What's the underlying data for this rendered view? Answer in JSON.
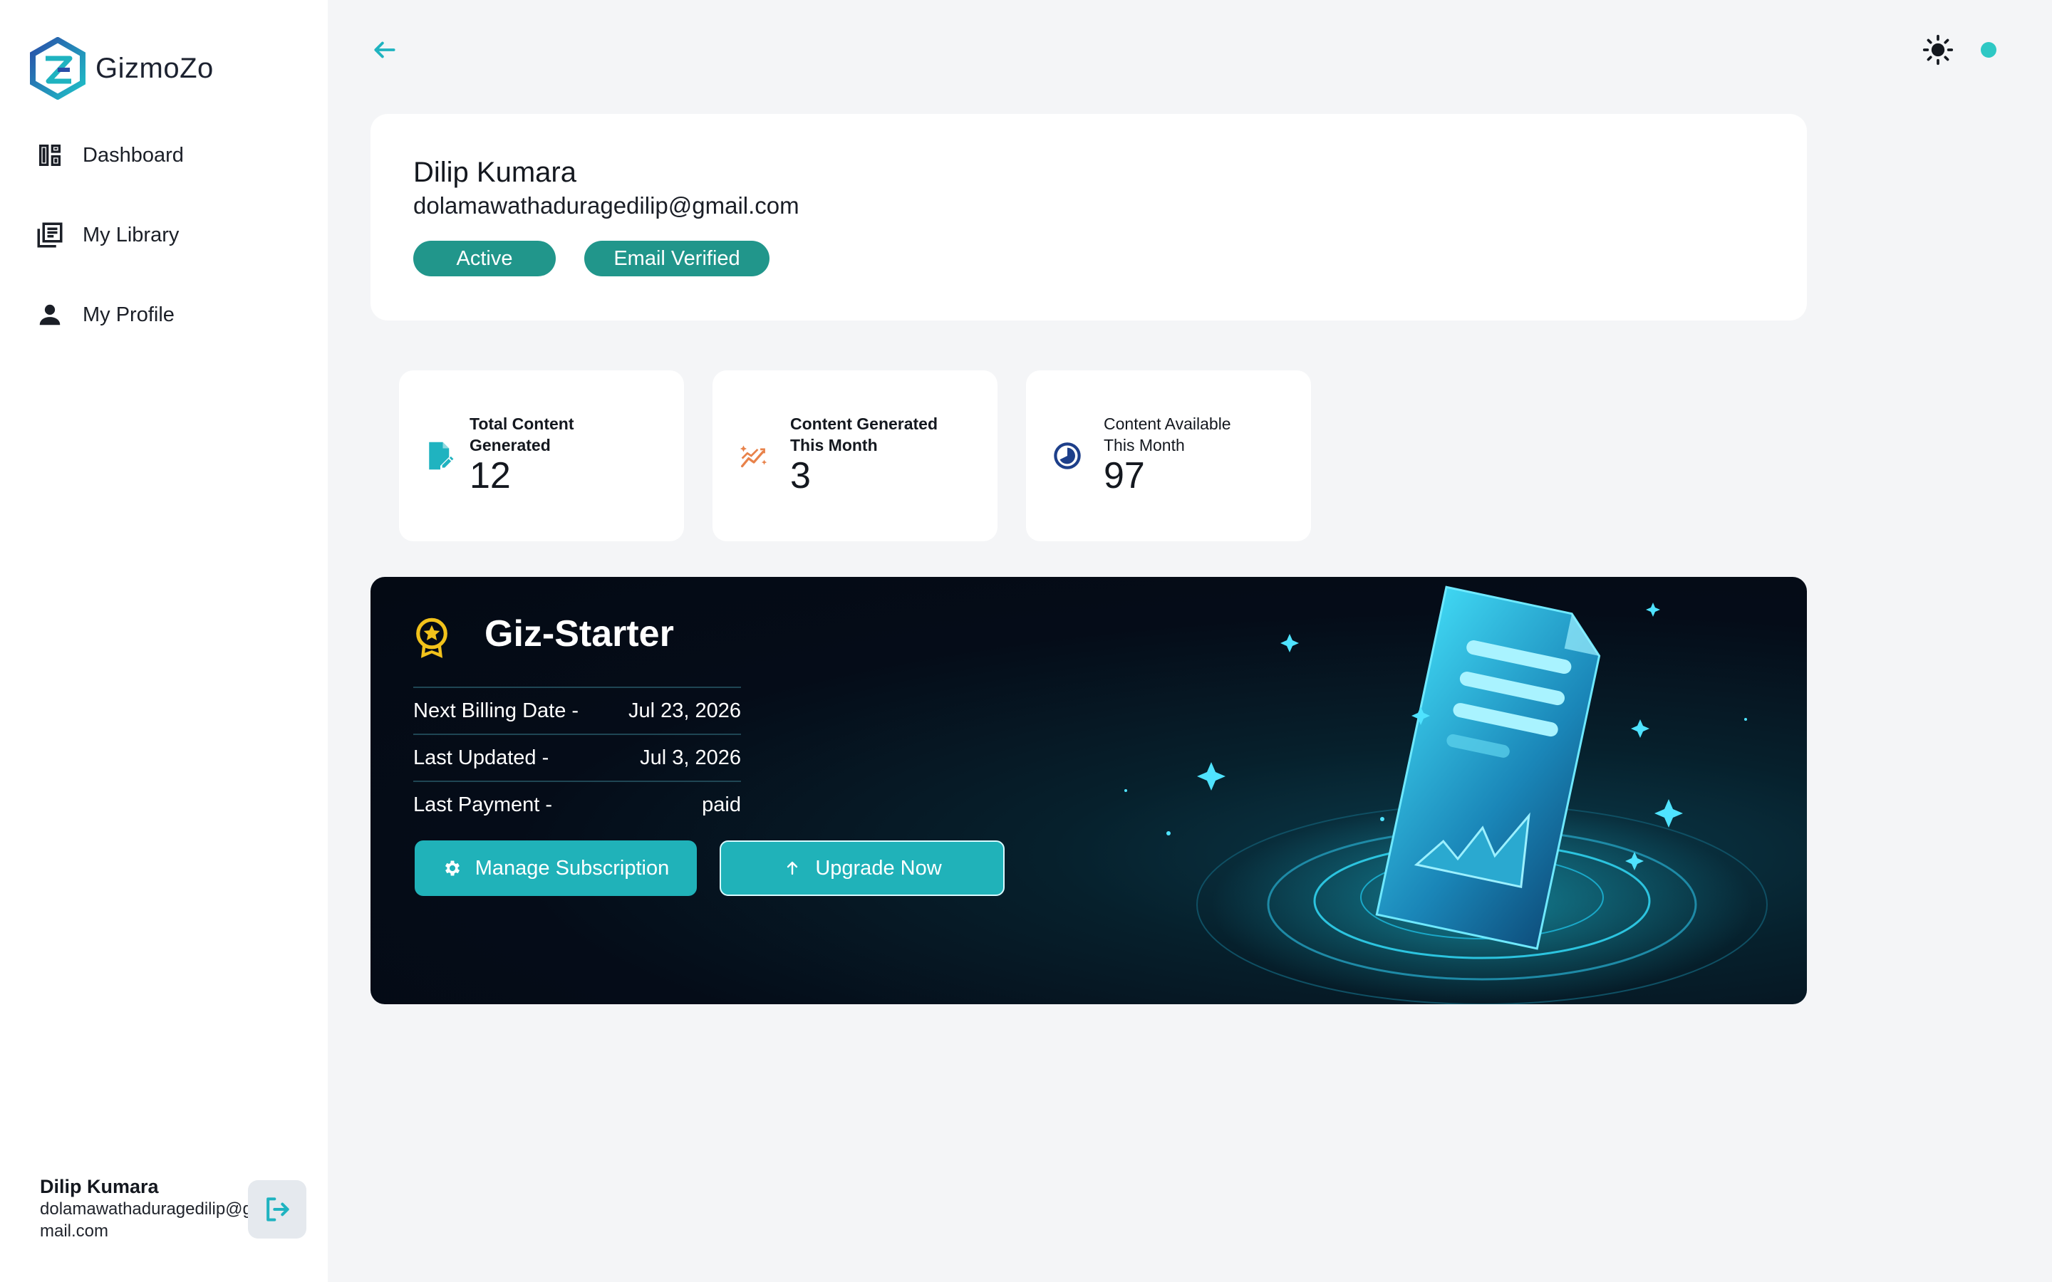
{
  "app": {
    "brand": "GizmoZo"
  },
  "sidebar": {
    "items": [
      {
        "label": "Dashboard",
        "icon": "dashboard-icon"
      },
      {
        "label": "My Library",
        "icon": "library-icon"
      },
      {
        "label": "My Profile",
        "icon": "person-icon"
      }
    ],
    "user": {
      "name": "Dilip Kumara",
      "email": "dolamawathaduragedilip@gmail.com"
    },
    "logout_icon": "logout-icon"
  },
  "topbar": {
    "back_icon": "arrow-left-icon",
    "theme_icon": "sun-icon",
    "status_color": "#2ec8c4"
  },
  "profile": {
    "name": "Dilip Kumara",
    "email": "dolamawathaduragedilip@gmail.com",
    "badges": [
      "Active",
      "Email Verified"
    ]
  },
  "stats": [
    {
      "label": "Total Content Generated",
      "value": "12",
      "icon": "edit-document-icon"
    },
    {
      "label": "Content Generated This Month",
      "value": "3",
      "icon": "sparkle-trend-icon"
    },
    {
      "label": "Content Available This Month",
      "value": "97",
      "icon": "pie-clock-icon"
    }
  ],
  "plan": {
    "name": "Giz-Starter",
    "icon": "award-badge-icon",
    "rows": [
      {
        "label": "Next Billing Date -",
        "value": "Jul 23, 2026"
      },
      {
        "label": "Last Updated -",
        "value": "Jul 3, 2026"
      },
      {
        "label": "Last Payment -",
        "value": "paid"
      }
    ],
    "buttons": {
      "manage": "Manage Subscription",
      "upgrade": "Upgrade Now"
    }
  },
  "colors": {
    "accent": "#20b2b9",
    "badge": "#21968b",
    "plan_bg": "#040a14",
    "stat_icon_1": "#1fb3c0",
    "stat_icon_2": "#e8824a",
    "stat_icon_3": "#1d3f8a",
    "plan_icon": "#f2c21b"
  }
}
